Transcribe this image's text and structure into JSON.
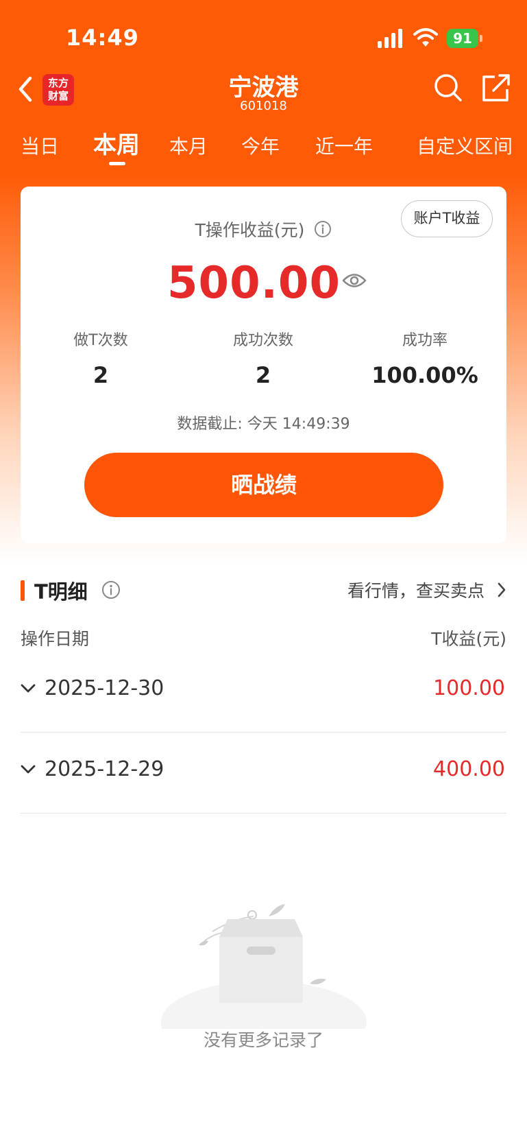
{
  "status_bar": {
    "time": "14:49",
    "battery": "91"
  },
  "header": {
    "back_icon": "chevron-left-icon",
    "logo_text": "东方\n财富",
    "title": "宁波港",
    "subtitle": "601018",
    "search_icon": "search-icon",
    "share_icon": "share-icon"
  },
  "tabs": [
    {
      "label": "当日",
      "active": false
    },
    {
      "label": "本周",
      "active": true
    },
    {
      "label": "本月",
      "active": false
    },
    {
      "label": "今年",
      "active": false
    },
    {
      "label": "近一年",
      "active": false
    },
    {
      "label": "自定义区间",
      "active": false
    }
  ],
  "summary": {
    "account_button": "账户T收益",
    "metric_label": "T操作收益(元)",
    "metric_value": "500.00",
    "stats": [
      {
        "label": "做T次数",
        "value": "2"
      },
      {
        "label": "成功次数",
        "value": "2"
      },
      {
        "label": "成功率",
        "value": "100.00%"
      }
    ],
    "data_time": "数据截止: 今天 14:49:39",
    "share_button": "晒战绩"
  },
  "detail": {
    "title": "T明细",
    "market_link": "看行情，查买卖点",
    "col_date": "操作日期",
    "col_income": "T收益(元)",
    "rows": [
      {
        "date": "2025-12-30",
        "amount": "100.00"
      },
      {
        "date": "2025-12-29",
        "amount": "400.00"
      }
    ],
    "empty_text": "没有更多记录了"
  },
  "colors": {
    "brand_orange": "#ff5507",
    "profit_red": "#e62a2a"
  }
}
